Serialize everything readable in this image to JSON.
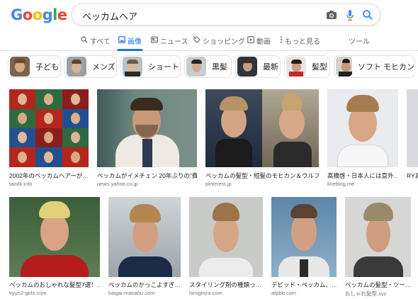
{
  "logo": {
    "letters": [
      "G",
      "o",
      "o",
      "g",
      "l",
      "e"
    ],
    "colors": [
      "#4285f4",
      "#ea4335",
      "#fbbc05",
      "#4285f4",
      "#34a853",
      "#ea4335"
    ]
  },
  "search": {
    "query": "ベッカムヘア"
  },
  "tabs": [
    {
      "label": "すべて",
      "icon": "search-icon"
    },
    {
      "label": "画像",
      "icon": "image-icon"
    },
    {
      "label": "ニュース",
      "icon": "news-icon"
    },
    {
      "label": "ショッピング",
      "icon": "shopping-tag-icon"
    },
    {
      "label": "動画",
      "icon": "video-play-icon"
    },
    {
      "label": "もっと見る",
      "icon": "more-vert-icon"
    },
    {
      "label": "ツール"
    }
  ],
  "chips": [
    {
      "label": "子ども"
    },
    {
      "label": "メンズ"
    },
    {
      "label": "ショート"
    },
    {
      "label": "黒髪"
    },
    {
      "label": "最新"
    },
    {
      "label": "髪型"
    },
    {
      "label": "ソフト モヒカン"
    }
  ],
  "results": [
    {
      "caption": "2002年のベッカムヘアーが…",
      "source": "tandk.info"
    },
    {
      "caption": "ベッカムがイメチェン 20年ぶりの\"費…",
      "source": "news.yahoo.co.jp"
    },
    {
      "caption": "ベッカムの髪型・短髪のモヒカン＆ウルフ…",
      "source": "pinterest.jp"
    },
    {
      "caption": "髙橋啓・日本人には意外…",
      "source": "lineblog.me"
    },
    {
      "caption": "RYお",
      "source": ""
    },
    {
      "caption": "ベッカムのおしゃれな髪型7選！…",
      "source": "kyun2-girls.com"
    },
    {
      "caption": "ベッカムのかっこよすぎ…",
      "source": "kaigai-manabu.com"
    },
    {
      "caption": "スタイリング剤の種類っ…",
      "source": "hiroginza.com"
    },
    {
      "caption": "デビッド・ベッカム、…",
      "source": "afpbb.com"
    },
    {
      "caption": "ベッカムの髪型・ツー…",
      "source": "おしゃれ髪型.xyz"
    }
  ],
  "colors": {
    "accent": "#1a73e8",
    "text_secondary": "#70757a",
    "border": "#dfe1e5"
  }
}
